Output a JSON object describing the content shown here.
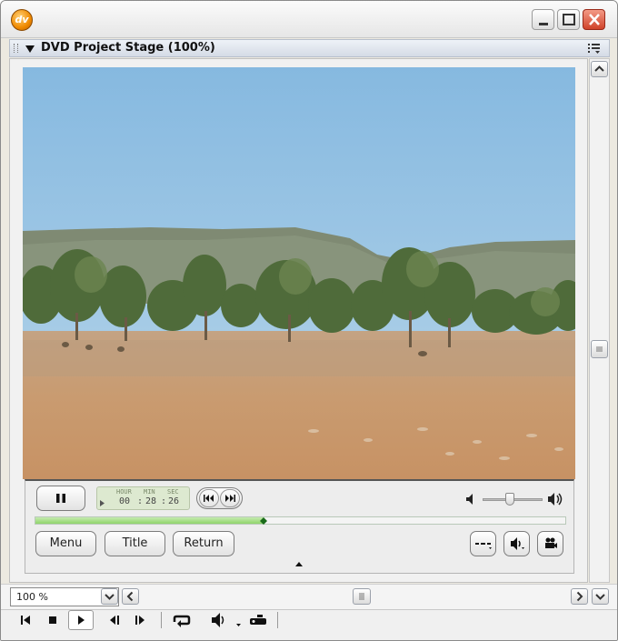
{
  "window": {
    "app_logo_text": "dv",
    "panel_title": "DVD Project Stage (100%)"
  },
  "player": {
    "timecode": {
      "hour_label": "HOUR",
      "min_label": "MIN",
      "sec_label": "SEC",
      "hour": "00",
      "min": "28",
      "sec": "26"
    },
    "progress_fraction": 0.43,
    "volume_fraction": 0.44,
    "buttons": {
      "menu": "Menu",
      "title": "Title",
      "return": "Return"
    }
  },
  "footer": {
    "zoom_value": "100 %"
  },
  "colors": {
    "close_button": "#d0432a",
    "progress_green": "#8fd46a",
    "sky": "#9dc7e6"
  },
  "icons": [
    "pause-icon",
    "previous-chapter-icon",
    "next-chapter-icon",
    "volume-low-icon",
    "volume-high-icon",
    "subtitle-icon",
    "audio-track-icon",
    "camera-angle-icon",
    "go-to-start-icon",
    "stop-icon",
    "play-icon",
    "step-back-icon",
    "step-forward-icon",
    "loop-icon",
    "volume-icon",
    "video-device-icon"
  ]
}
